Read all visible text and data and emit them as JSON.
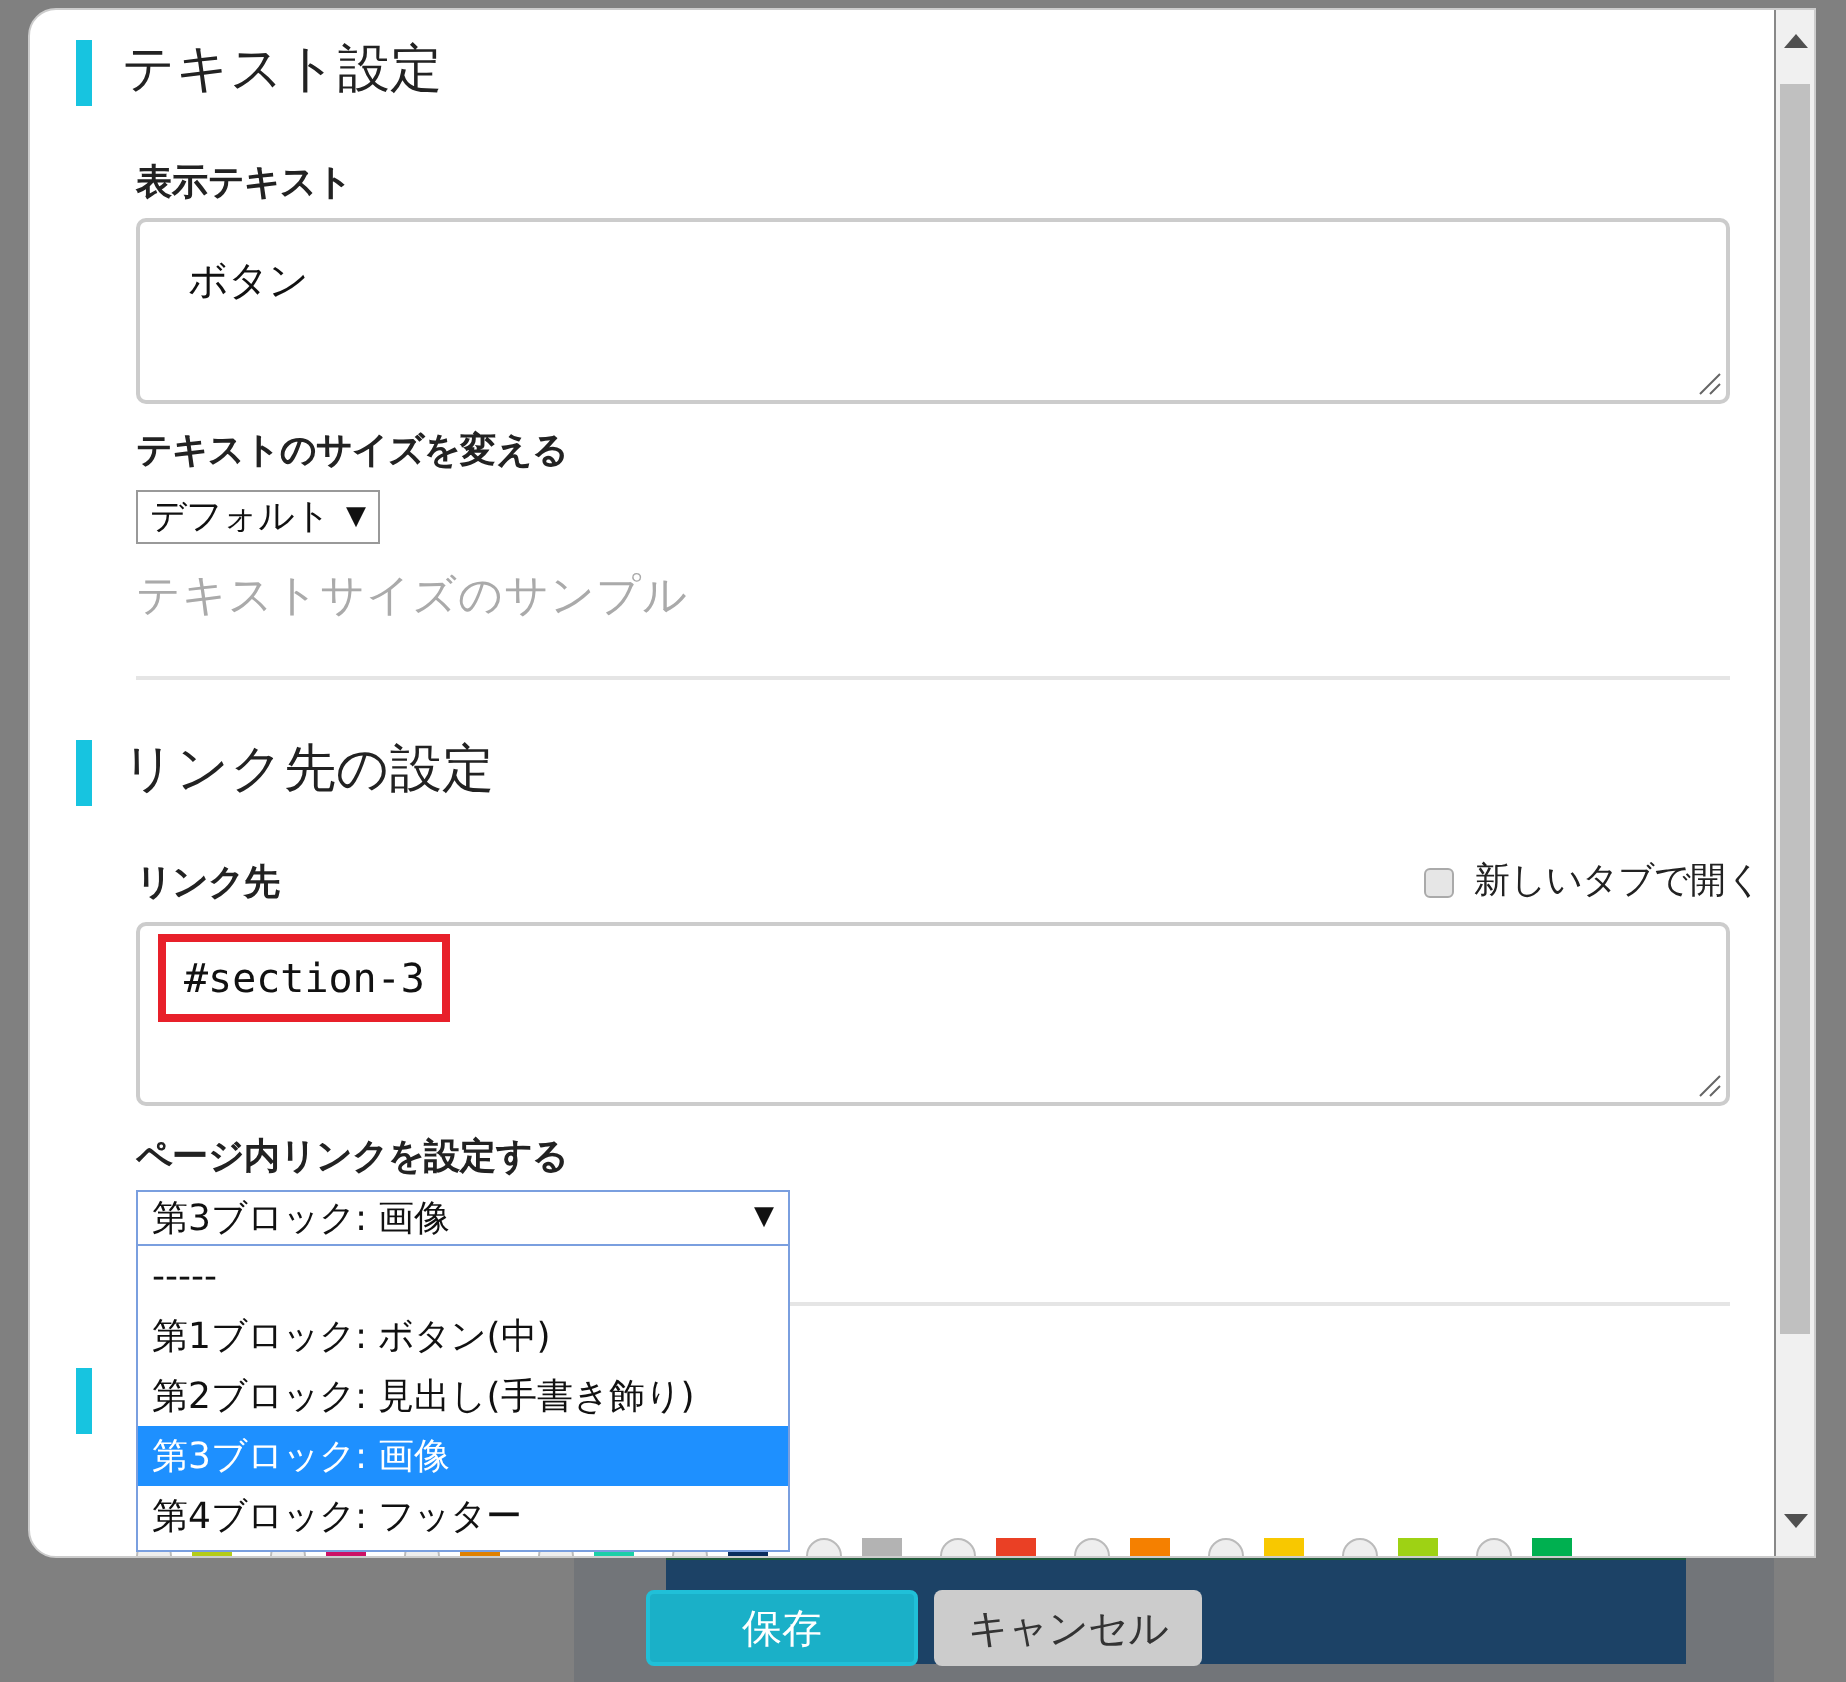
{
  "text_settings": {
    "heading": "テキスト設定",
    "display_text": {
      "label": "表示テキスト",
      "value": "ボタン"
    },
    "size": {
      "label": "テキストのサイズを変える",
      "value": "デフォルト",
      "arrow": "▼",
      "sample": "テキストサイズのサンプル"
    }
  },
  "link_settings": {
    "heading": "リンク先の設定",
    "target": {
      "label": "リンク先",
      "value": "#section-3",
      "highlighted": true
    },
    "new_tab": {
      "label": "新しいタブで開く",
      "checked": false
    },
    "page_link": {
      "label": "ページ内リンクを設定する",
      "value": "第3ブロック: 画像",
      "arrow": "▼",
      "expanded": true,
      "options": [
        {
          "label": "-----",
          "selected": false
        },
        {
          "label": "第1ブロック: ボタン(中)",
          "selected": false
        },
        {
          "label": "第2ブロック: 見出し(手書き飾り)",
          "selected": false
        },
        {
          "label": "第3ブロック: 画像",
          "selected": true
        },
        {
          "label": "第4ブロック: フッター",
          "selected": false
        }
      ]
    }
  },
  "swatches": [
    {
      "color": "#b5cc18"
    },
    {
      "color": "#cc1166"
    },
    {
      "color": "#e08000"
    },
    {
      "color": "#1ccfa8"
    },
    {
      "color": "#0a2d5e"
    },
    {
      "color": "#b3b3b3"
    },
    {
      "color": "#ea4025"
    },
    {
      "color": "#f58000"
    },
    {
      "color": "#f8c800"
    },
    {
      "color": "#9ed214"
    },
    {
      "color": "#00b050"
    }
  ],
  "buttons": [
    {
      "label": "保存",
      "kind": "primary"
    },
    {
      "label": "キャンセル",
      "kind": "secondary"
    }
  ]
}
